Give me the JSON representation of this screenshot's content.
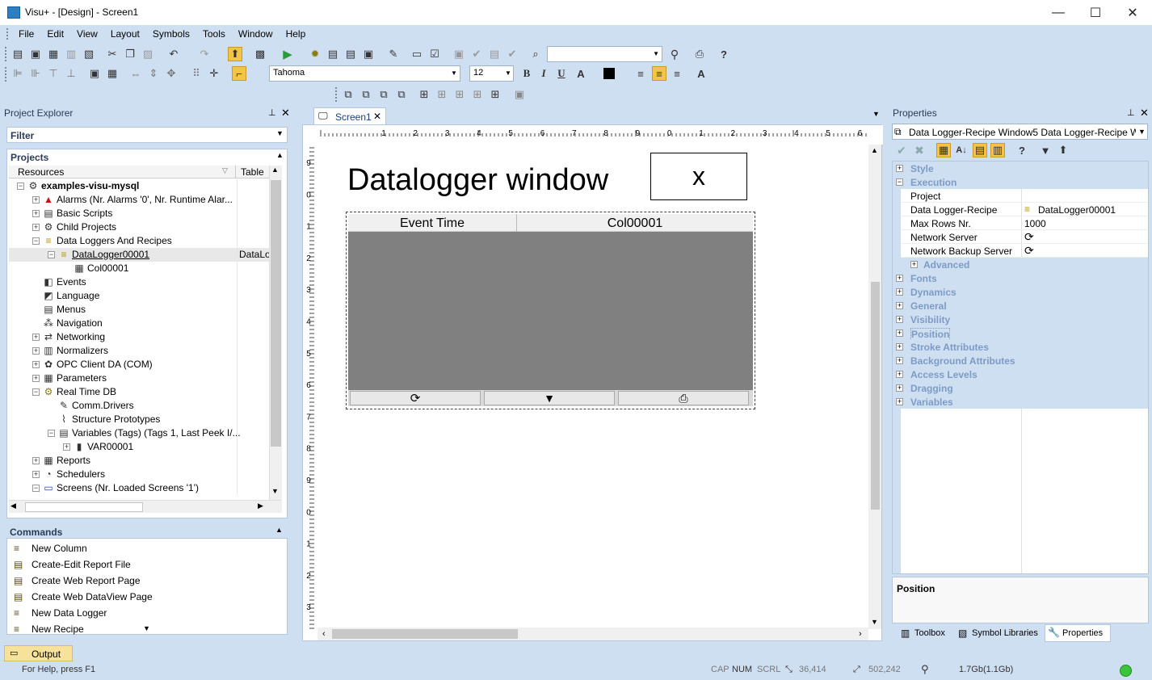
{
  "window": {
    "title": "Visu+ - [Design] - Screen1",
    "minimize": "—",
    "maximize": "☐",
    "close": "✕"
  },
  "menu": [
    "File",
    "Edit",
    "View",
    "Layout",
    "Symbols",
    "Tools",
    "Window",
    "Help"
  ],
  "format_toolbar": {
    "font": "Tahoma",
    "size": "12"
  },
  "project_explorer": {
    "title": "Project Explorer",
    "filter_label": "Filter",
    "projects_label": "Projects",
    "columns": [
      "Resources",
      "Table"
    ],
    "tree": [
      {
        "label": "examples-visu-mysql",
        "level": 0,
        "exp": "−",
        "icon": "gear-icon",
        "bold": true
      },
      {
        "label": "Alarms (Nr. Alarms '0', Nr. Runtime Alar...",
        "level": 1,
        "exp": "+",
        "icon": "alarm-bell-icon"
      },
      {
        "label": "Basic Scripts",
        "level": 1,
        "exp": "+",
        "icon": "script-icon"
      },
      {
        "label": "Child Projects",
        "level": 1,
        "exp": "+",
        "icon": "child-projects-icon"
      },
      {
        "label": "Data Loggers And Recipes",
        "level": 1,
        "exp": "−",
        "icon": "database-icon"
      },
      {
        "label": "DataLogger00001",
        "level": 2,
        "exp": "−",
        "icon": "datalogger-icon",
        "table": "DataLo",
        "selected": true
      },
      {
        "label": "Col00001",
        "level": 3,
        "exp": "",
        "icon": "column-icon"
      },
      {
        "label": "Events",
        "level": 1,
        "exp": "",
        "icon": "events-icon"
      },
      {
        "label": "Language",
        "level": 1,
        "exp": "",
        "icon": "language-icon"
      },
      {
        "label": "Menus",
        "level": 1,
        "exp": "",
        "icon": "menus-icon"
      },
      {
        "label": "Navigation",
        "level": 1,
        "exp": "",
        "icon": "navigation-icon"
      },
      {
        "label": "Networking",
        "level": 1,
        "exp": "+",
        "icon": "networking-icon"
      },
      {
        "label": "Normalizers",
        "level": 1,
        "exp": "+",
        "icon": "normalizers-icon"
      },
      {
        "label": "OPC Client DA (COM)",
        "level": 1,
        "exp": "+",
        "icon": "opc-icon"
      },
      {
        "label": "Parameters",
        "level": 1,
        "exp": "+",
        "icon": "parameters-icon"
      },
      {
        "label": "Real Time DB",
        "level": 1,
        "exp": "−",
        "icon": "realtime-db-icon"
      },
      {
        "label": "Comm.Drivers",
        "level": 2,
        "exp": "",
        "icon": "comm-drivers-icon"
      },
      {
        "label": "Structure Prototypes",
        "level": 2,
        "exp": "",
        "icon": "structure-icon"
      },
      {
        "label": "Variables (Tags) (Tags 1, Last Peek I/...",
        "level": 2,
        "exp": "−",
        "icon": "variables-icon"
      },
      {
        "label": "VAR00001",
        "level": 3,
        "exp": "+",
        "icon": "variable-icon"
      },
      {
        "label": "Reports",
        "level": 1,
        "exp": "+",
        "icon": "reports-icon"
      },
      {
        "label": "Schedulers",
        "level": 1,
        "exp": "+",
        "icon": "schedulers-icon"
      },
      {
        "label": "Screens (Nr. Loaded Screens '1')",
        "level": 1,
        "exp": "−",
        "icon": "screens-icon"
      }
    ]
  },
  "commands": {
    "title": "Commands",
    "items": [
      "New Column",
      "Create-Edit Report File",
      "Create Web Report Page",
      "Create Web DataView Page",
      "New Data Logger",
      "New Recipe"
    ]
  },
  "output_tab": "Output",
  "editor": {
    "tab": "Screen1",
    "ruler_labels": [
      "1",
      "2",
      "3",
      "4",
      "5",
      "6",
      "7",
      "8",
      "9",
      "0",
      "1",
      "2",
      "3",
      "4",
      "5",
      "6",
      "7"
    ],
    "vruler_labels": [
      "9",
      "0",
      "1",
      "2",
      "3",
      "4",
      "5",
      "6",
      "7",
      "8",
      "9",
      "0",
      "1",
      "2",
      "3"
    ],
    "heading": "Datalogger window",
    "close_box": "x",
    "grid_columns": [
      "Event Time",
      "Col00001"
    ]
  },
  "properties": {
    "title": "Properties",
    "selector": "Data Logger-Recipe Window5 Data Logger-Recipe W",
    "rows": [
      {
        "label": "Style",
        "type": "cat",
        "exp": "+"
      },
      {
        "label": "Execution",
        "type": "cat",
        "exp": "−"
      },
      {
        "label": "Project",
        "type": "prop",
        "value": ""
      },
      {
        "label": "Data Logger-Recipe",
        "type": "prop",
        "value": "DataLogger00001"
      },
      {
        "label": "Max Rows Nr.",
        "type": "prop",
        "value": "1000"
      },
      {
        "label": "Network Server",
        "type": "prop",
        "value": ""
      },
      {
        "label": "Network Backup Server",
        "type": "prop",
        "value": ""
      },
      {
        "label": "Advanced",
        "type": "subcat",
        "exp": "+"
      },
      {
        "label": "Fonts",
        "type": "cat",
        "exp": "+"
      },
      {
        "label": "Dynamics",
        "type": "cat",
        "exp": "+"
      },
      {
        "label": "General",
        "type": "cat",
        "exp": "+"
      },
      {
        "label": "Visibility",
        "type": "cat",
        "exp": "+"
      },
      {
        "label": "Position",
        "type": "cat",
        "exp": "+"
      },
      {
        "label": "Stroke Attributes",
        "type": "cat",
        "exp": "+"
      },
      {
        "label": "Background Attributes",
        "type": "cat",
        "exp": "+"
      },
      {
        "label": "Access Levels",
        "type": "cat",
        "exp": "+"
      },
      {
        "label": "Dragging",
        "type": "cat",
        "exp": "+"
      },
      {
        "label": "Variables",
        "type": "cat",
        "exp": "+"
      }
    ],
    "description_title": "Position",
    "bottom_tabs": [
      "Toolbox",
      "Symbol Libraries",
      "Properties"
    ]
  },
  "status": {
    "help": "For Help, press F1",
    "cap": "CAP",
    "num": "NUM",
    "scrl": "SCRL",
    "pos": "36,414",
    "size": "502,242",
    "memory": "1.7Gb(1.1Gb)"
  }
}
